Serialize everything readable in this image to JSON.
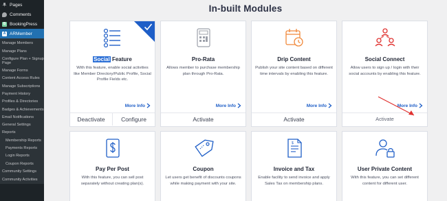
{
  "sidebar": {
    "top_items": [
      {
        "label": "Pages",
        "icon": "pages-icon"
      },
      {
        "label": "Comments",
        "icon": "comments-icon"
      },
      {
        "label": "BookingPress",
        "icon": "bookingpress-icon"
      },
      {
        "label": "ARMember",
        "icon": "armember-icon"
      }
    ],
    "sub_items": [
      "Manage Members",
      "Manage Plans",
      "Configure Plan + Signup Page",
      "Manage Forms",
      "Content Access Rules",
      "Manage Subscriptions",
      "Payment History",
      "Profiles & Directories",
      "Badges & Achievements",
      "Email Notifications",
      "General Settings",
      "Reports",
      "Membership Reports",
      "Payments Reports",
      "Login Reports",
      "Coupon Reports",
      "Community Settings",
      "Community Activities"
    ]
  },
  "page": {
    "title": "In-built Modules"
  },
  "modules": [
    {
      "title_highlight": "Social",
      "title_rest": " Feature",
      "description": "With this feature, enable social activities like Member Directory/Public Profile, Social Profile Fields etc.",
      "more_info": "More Info",
      "buttons": [
        "Deactivate",
        "Configure"
      ],
      "icon": "list-check-icon"
    },
    {
      "title": "Pro-Rata",
      "description": "Allows member to purchase membership plan through Pro-Rata.",
      "more_info": "More Info",
      "button": "Activate",
      "icon": "calculator-document-icon"
    },
    {
      "title": "Drip Content",
      "description": "Publish your site content based on different time intervals by enabling this feature.",
      "more_info": "More Info",
      "button": "Activate",
      "icon": "calendar-clock-icon"
    },
    {
      "title": "Social Connect",
      "description": "Allow users to sign up / login with their social accounts by enabling this feature.",
      "more_info": "More Info",
      "button": "Activate",
      "icon": "network-users-icon"
    },
    {
      "title": "Pay Per Post",
      "description": "With this feature, you can sell post separately without creating plan(s).",
      "icon": "dollar-document-icon"
    },
    {
      "title": "Coupon",
      "description": "Let users get benefit of discounts coupons while making payment with your site.",
      "icon": "coupon-tag-icon"
    },
    {
      "title": "Invoice and Tax",
      "description": "Enable facility to send invoice and apply Sales Tax on membership plans.",
      "icon": "invoice-icon"
    },
    {
      "title": "User Private Content",
      "description": "With this feature, you can set different content for different user.",
      "icon": "user-lock-icon"
    }
  ],
  "colors": {
    "accent": "#1e5ec7",
    "sidebar_bg": "#1d2327",
    "active_bg": "#2271b1",
    "annotation_arrow": "#e0312f"
  }
}
